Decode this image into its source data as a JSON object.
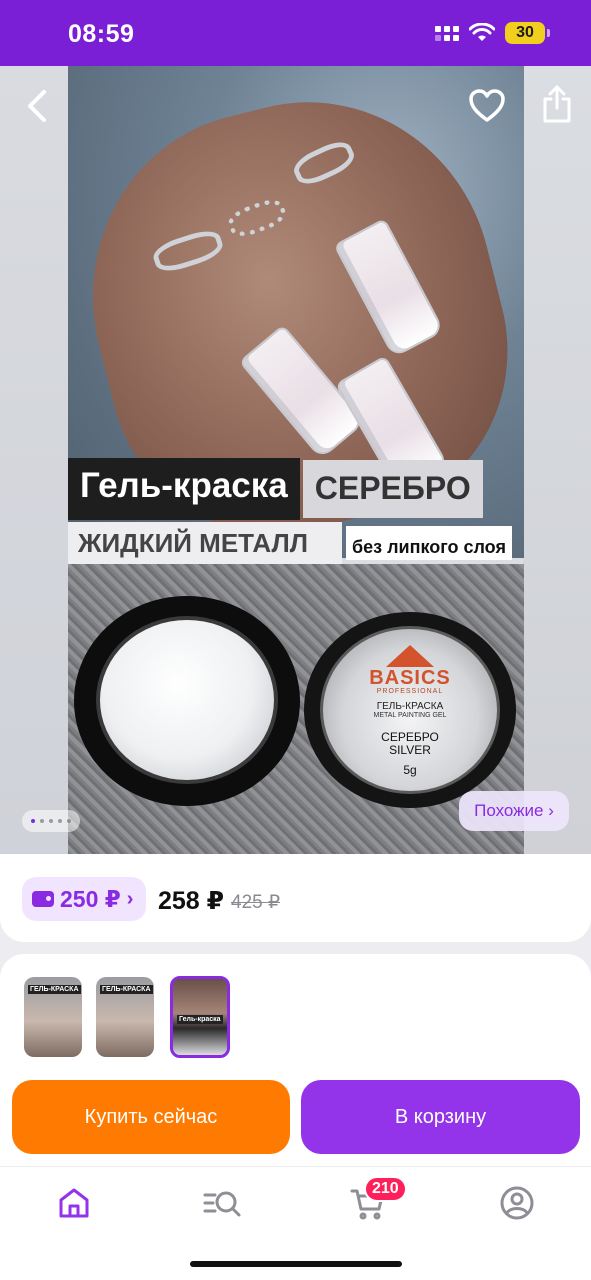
{
  "status_bar": {
    "time": "08:59",
    "battery": "30"
  },
  "product_image": {
    "title_main": "Гель-краска",
    "title_color": "СЕРЕБРО",
    "subtitle": "ЖИДКИЙ МЕТАЛЛ",
    "subtitle_note": "без липкого слоя",
    "jar_brand": "BASICS",
    "jar_brand_sub": "PROFESSIONAL",
    "jar_name": "ГЕЛЬ-КРАСКА",
    "jar_name_sub": "METAL PAINTING GEL",
    "jar_color_ru": "СЕРЕБРО",
    "jar_color_en": "SILVER",
    "jar_weight": "5g",
    "carousel_pages": 5,
    "carousel_active": 1
  },
  "nav": {
    "back_icon": "chevron-left-icon",
    "favorite_icon": "heart-icon",
    "share_icon": "share-icon"
  },
  "similar_label": "Похожие ›",
  "price": {
    "bonus": "250 ₽",
    "bonus_chevron": "›",
    "current": "258 ₽",
    "old": "425 ₽"
  },
  "thumbnails": [
    {
      "tag": "ГЕЛЬ-КРАСКА"
    },
    {
      "tag": "ГЕЛЬ-КРАСКА"
    },
    {
      "tag": "Гель-краска",
      "selected": true
    }
  ],
  "actions": {
    "buy_now": "Купить сейчас",
    "add_to_cart": "В корзину"
  },
  "tabbar": {
    "cart_badge": "210"
  },
  "colors": {
    "brand_purple": "#9333ea",
    "status_bar": "#7a1fd6",
    "buy_orange": "#ff7a00",
    "badge_red": "#ff1f5a"
  }
}
